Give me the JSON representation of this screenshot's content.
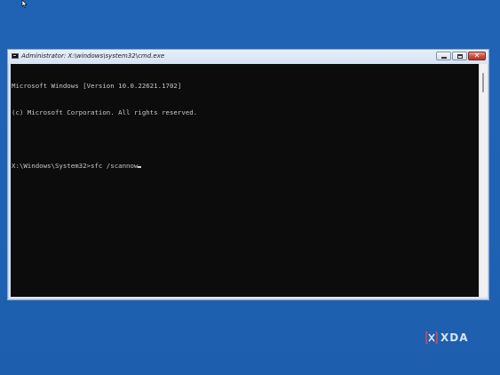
{
  "window": {
    "title": "Administrator: X:\\windows\\system32\\cmd.exe",
    "icon": "cmd-icon",
    "controls": {
      "minimize_icon": "minimize-icon",
      "maximize_icon": "maximize-icon",
      "close_icon": "close-icon",
      "close_glyph": "✕"
    }
  },
  "console": {
    "lines": [
      "Microsoft Windows [Version 10.0.22621.1702]",
      "(c) Microsoft Corporation. All rights reserved.",
      "",
      "X:\\Windows\\System32>sfc /scannow"
    ],
    "background": "#0c0c0c",
    "foreground": "#c8c8c8"
  },
  "desktop": {
    "background": "#1f62b3",
    "watermark_text": "XDA"
  },
  "colors": {
    "close_button": "#c9503c",
    "titlebar": "#dbe7f5"
  }
}
